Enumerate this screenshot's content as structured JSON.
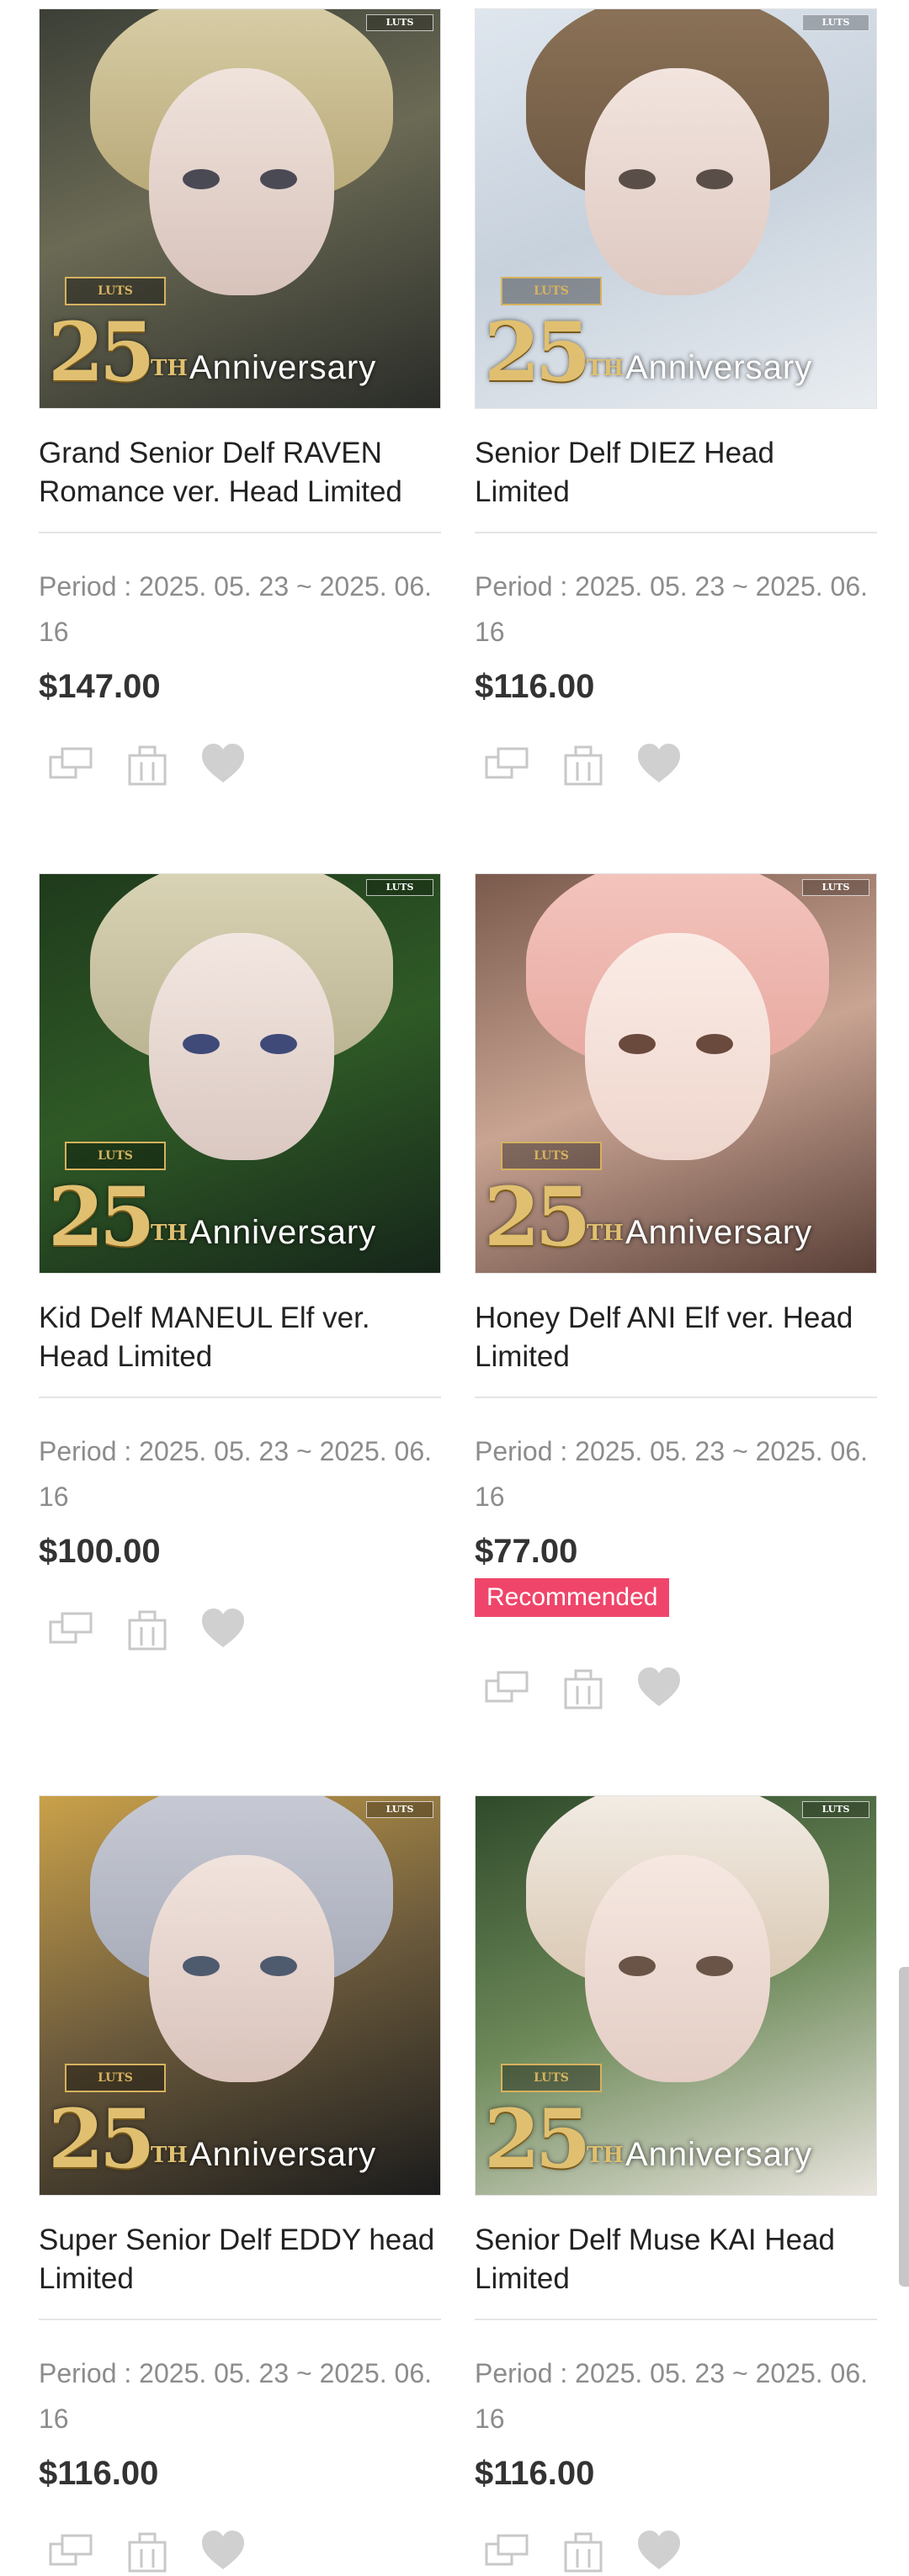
{
  "products": [
    {
      "title": "Grand Senior Delf RAVEN Romance ver. Head Limited",
      "period": "Period : 2025. 05. 23 ~ 2025. 06. 16",
      "price": "$147.00",
      "recommended": "",
      "image": {
        "brand": "LUTS",
        "logo": "LUTS",
        "num": "25",
        "th": "TH",
        "anniversary": "Anniversary"
      }
    },
    {
      "title": "Senior Delf DIEZ Head Limited",
      "period": "Period : 2025. 05. 23 ~ 2025. 06. 16",
      "price": "$116.00",
      "recommended": "",
      "image": {
        "brand": "LUTS",
        "logo": "LUTS",
        "num": "25",
        "th": "TH",
        "anniversary": "Anniversary"
      }
    },
    {
      "title": "Kid Delf MANEUL Elf ver. Head Limited",
      "period": "Period : 2025. 05. 23 ~ 2025. 06. 16",
      "price": "$100.00",
      "recommended": "",
      "image": {
        "brand": "LUTS",
        "logo": "LUTS",
        "num": "25",
        "th": "TH",
        "anniversary": "Anniversary"
      }
    },
    {
      "title": "Honey Delf ANI Elf ver. Head Limited",
      "period": "Period : 2025. 05. 23 ~ 2025. 06. 16",
      "price": "$77.00",
      "recommended": "Recommended",
      "image": {
        "brand": "LUTS",
        "logo": "LUTS",
        "num": "25",
        "th": "TH",
        "anniversary": "Anniversary"
      }
    },
    {
      "title": "Super Senior Delf EDDY head Limited",
      "period": "Period : 2025. 05. 23 ~ 2025. 06. 16",
      "price": "$116.00",
      "recommended": "",
      "image": {
        "brand": "LUTS",
        "logo": "LUTS",
        "num": "25",
        "th": "TH",
        "anniversary": "Anniversary"
      }
    },
    {
      "title": "Senior Delf Muse KAI Head Limited",
      "period": "Period : 2025. 05. 23 ~ 2025. 06. 16",
      "price": "$116.00",
      "recommended": "",
      "image": {
        "brand": "LUTS",
        "logo": "LUTS",
        "num": "25",
        "th": "TH",
        "anniversary": "Anniversary"
      }
    }
  ],
  "icons": {
    "zoom": "zoom-window-icon",
    "cart": "cart-icon",
    "wish": "heart-icon"
  },
  "colors": {
    "recommended_badge": "#f0456a",
    "icon": "#c8c8c8",
    "divider": "#e5e5e5",
    "period_text": "#8c8c8c"
  }
}
